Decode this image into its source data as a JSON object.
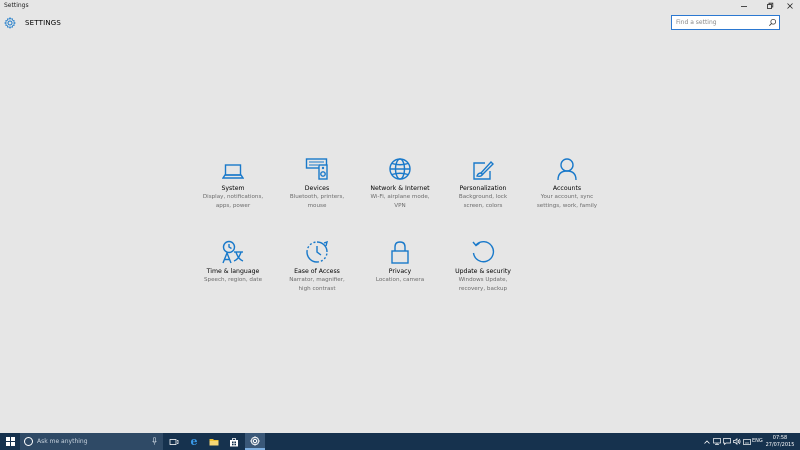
{
  "window": {
    "title": "Settings",
    "controls": [
      "minimize",
      "restore",
      "close"
    ]
  },
  "header": {
    "title": "SETTINGS",
    "search_placeholder": "Find a setting"
  },
  "tiles": [
    {
      "label": "System",
      "desc1": "Display, notifications,",
      "desc2": "apps, power",
      "icon": "laptop-icon"
    },
    {
      "label": "Devices",
      "desc1": "Bluetooth, printers,",
      "desc2": "mouse",
      "icon": "devices-icon"
    },
    {
      "label": "Network & Internet",
      "desc1": "Wi-Fi, airplane mode,",
      "desc2": "VPN",
      "icon": "globe-icon"
    },
    {
      "label": "Personalization",
      "desc1": "Background, lock",
      "desc2": "screen, colors",
      "icon": "paint-icon"
    },
    {
      "label": "Accounts",
      "desc1": "Your account, sync",
      "desc2": "settings, work, family",
      "icon": "person-icon"
    },
    {
      "label": "Time & language",
      "desc1": "Speech, region, date",
      "desc2": "",
      "icon": "time-language-icon"
    },
    {
      "label": "Ease of Access",
      "desc1": "Narrator, magnifier,",
      "desc2": "high contrast",
      "icon": "ease-of-access-icon"
    },
    {
      "label": "Privacy",
      "desc1": "Location, camera",
      "desc2": "",
      "icon": "lock-icon"
    },
    {
      "label": "Update & security",
      "desc1": "Windows Update,",
      "desc2": "recovery, backup",
      "icon": "update-icon"
    }
  ],
  "taskbar": {
    "search_text": "Ask me anything",
    "language": "ENG",
    "time": "07:58",
    "date": "27/07/2015"
  },
  "colors": {
    "accent": "#1979ca",
    "taskbar": "#16324e",
    "background": "#e6e6e6"
  }
}
